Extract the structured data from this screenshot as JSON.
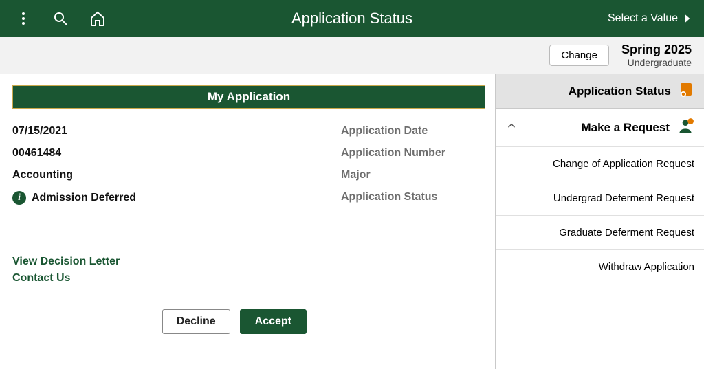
{
  "header": {
    "title": "Application Status",
    "select_value": "Select a Value"
  },
  "term": {
    "title": "2025 Spring",
    "level": "Undergraduate",
    "change": "Change"
  },
  "side": {
    "selected": "Application Status",
    "parent": "Make a Request",
    "children": [
      "Change of Application Request",
      "Undergrad Deferment Request",
      "Graduate Deferment Request",
      "Withdraw Application"
    ]
  },
  "panel": {
    "title": "My Application",
    "rows": {
      "app_date": {
        "label": "Application Date",
        "value": "07/15/2021"
      },
      "app_num": {
        "label": "Application Number",
        "value": "00461484"
      },
      "major": {
        "label": "Major",
        "value": "Accounting"
      },
      "app_status": {
        "label": "Application Status",
        "value": "Admission Deferred"
      }
    },
    "links": {
      "decision": "View Decision Letter",
      "contact": "Contact Us"
    },
    "buttons": {
      "accept": "Accept",
      "decline": "Decline"
    }
  }
}
